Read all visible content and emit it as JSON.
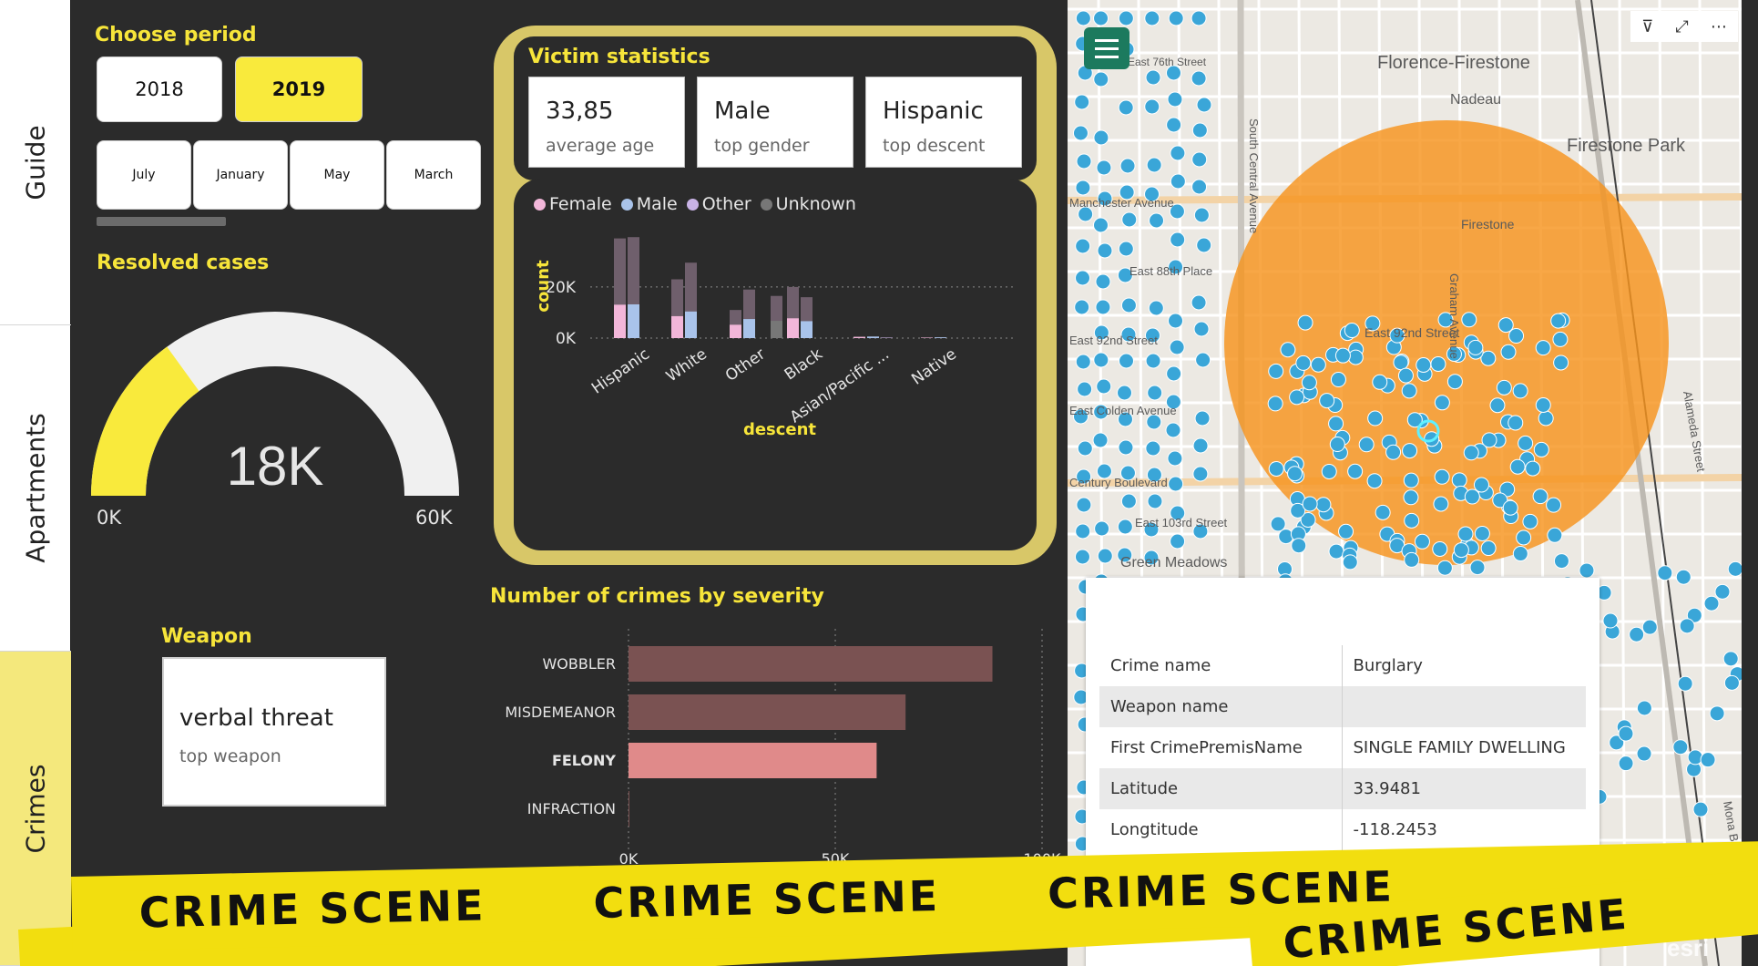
{
  "nav": {
    "tabs": [
      {
        "label": "Guide"
      },
      {
        "label": "Apartments"
      },
      {
        "label": "Crimes"
      }
    ]
  },
  "period": {
    "title": "Choose period",
    "years": [
      "2018",
      "2019"
    ],
    "selected_year": "2019",
    "months": [
      "July",
      "January",
      "May",
      "March"
    ]
  },
  "resolved": {
    "title": "Resolved cases",
    "value_label": "18K",
    "min_label": "0K",
    "max_label": "60K",
    "value": 18000,
    "min": 0,
    "max": 60000
  },
  "weapon": {
    "title": "Weapon",
    "value": "verbal threat",
    "caption": "top weapon"
  },
  "victim": {
    "title": "Victim statistics",
    "cards": [
      {
        "value": "33,85",
        "label": "average age"
      },
      {
        "value": "Male",
        "label": "top gender"
      },
      {
        "value": "Hispanic",
        "label": "top descent"
      }
    ],
    "legend": [
      {
        "name": "Female",
        "color": "#f2b6d9"
      },
      {
        "name": "Male",
        "color": "#a9c3ea"
      },
      {
        "name": "Other",
        "color": "#c9b3e6"
      },
      {
        "name": "Unknown",
        "color": "#777777"
      }
    ]
  },
  "severity": {
    "title": "Number of crimes by severity"
  },
  "chart_data": [
    {
      "type": "bar",
      "subtype": "grouped-stacked",
      "xlabel": "descent",
      "ylabel": "count",
      "ytick_labels": [
        "0K",
        "20K"
      ],
      "categories": [
        "Hispanic",
        "White",
        "Other",
        "Black",
        "Asian/Pacific ...",
        "Native"
      ],
      "series": [
        {
          "name": "Female",
          "values": [
            39000,
            23000,
            11000,
            20000,
            500,
            200
          ]
        },
        {
          "name": "Male",
          "values": [
            39500,
            29500,
            19000,
            16000,
            600,
            300
          ]
        },
        {
          "name": "Other",
          "values": [
            0,
            0,
            0,
            0,
            200,
            0
          ]
        },
        {
          "name": "Unknown",
          "values": [
            0,
            0,
            16500,
            0,
            0,
            0
          ]
        }
      ],
      "ylim": [
        0,
        41000
      ],
      "grid": true
    },
    {
      "type": "bar",
      "orientation": "horizontal",
      "categories": [
        "WOBBLER",
        "MISDEMEANOR",
        "FELONY",
        "INFRACTION"
      ],
      "values": [
        88000,
        67000,
        60000,
        100
      ],
      "highlight": "FELONY",
      "xtick_labels": [
        "0K",
        "50K",
        "100K"
      ],
      "xlim": [
        0,
        100000
      ],
      "colors": {
        "default": "#7a5252",
        "highlight": "#e08a8a"
      }
    }
  ],
  "map": {
    "labels": [
      "Florence-Firestone",
      "Nadeau",
      "Firestone Park",
      "Firestone",
      "East 92nd Street",
      "Manchester Avenue",
      "East 88th Place",
      "East 92nd Street",
      "East Colden Avenue",
      "Century Boulevard",
      "East 103rd Street",
      "Green Meadows",
      "South Central Avenue",
      "Graham Avenue",
      "Alameda Street",
      "Mona Boulevard",
      "East 76th Street"
    ],
    "popup": {
      "rows": [
        {
          "key": "Crime name",
          "value": "Burglary"
        },
        {
          "key": "Weapon name",
          "value": ""
        },
        {
          "key": "First CrimePremisName",
          "value": "SINGLE FAMILY DWELLING"
        },
        {
          "key": "Latitude",
          "value": "33.9481"
        },
        {
          "key": "Longtitude",
          "value": "-118.2453"
        }
      ]
    },
    "attribution": "esri",
    "colors": {
      "buffer": "#f7941d",
      "points": "#3aa6d8"
    }
  },
  "tape": {
    "text": "CRIME SCENE"
  }
}
